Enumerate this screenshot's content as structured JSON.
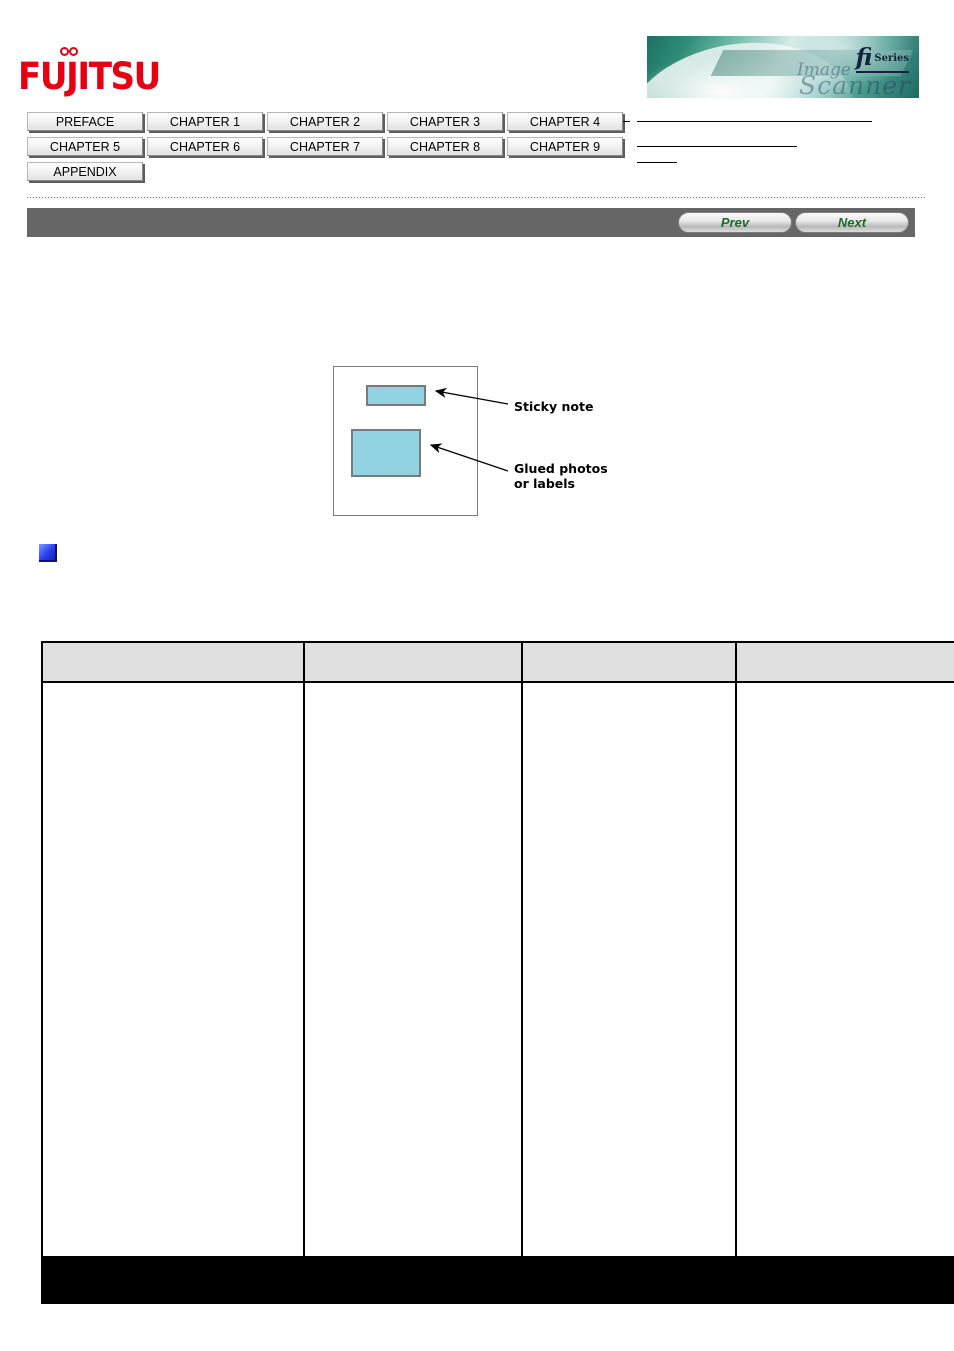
{
  "header": {
    "logo_text": "FUJITSU",
    "banner": {
      "product_mark": "fi",
      "product_series": "Series",
      "script_word_1": "Image",
      "script_word_2": "Scanner"
    }
  },
  "tab_nav": {
    "rows": [
      [
        {
          "label": "PREFACE"
        },
        {
          "label": "CHAPTER 1"
        },
        {
          "label": "CHAPTER 2"
        },
        {
          "label": "CHAPTER 3"
        },
        {
          "label": "CHAPTER 4"
        }
      ],
      [
        {
          "label": "CHAPTER 5"
        },
        {
          "label": "CHAPTER 6"
        },
        {
          "label": "CHAPTER 7"
        },
        {
          "label": "CHAPTER 8"
        },
        {
          "label": "CHAPTER 9"
        }
      ],
      [
        {
          "label": "APPENDIX"
        }
      ]
    ]
  },
  "nav_bar": {
    "prev_label": "Prev",
    "next_label": "Next"
  },
  "figure": {
    "sticky_note_label": "Sticky note",
    "glued_photo_label_line1": "Glued photos",
    "glued_photo_label_line2": "or labels"
  },
  "table": {
    "headers": [
      "",
      "",
      "",
      ""
    ],
    "rows": [
      [
        "",
        "",
        "",
        ""
      ]
    ],
    "footer": [
      "",
      "",
      "",
      ""
    ]
  },
  "colors": {
    "brand_red": "#e60012",
    "nav_bar_gray": "#666666",
    "button_green": "#1d6b2c",
    "figure_blue": "#92d3e3",
    "marker_blue": "#2a3ef0",
    "table_header_gray": "#e0e0e0"
  }
}
